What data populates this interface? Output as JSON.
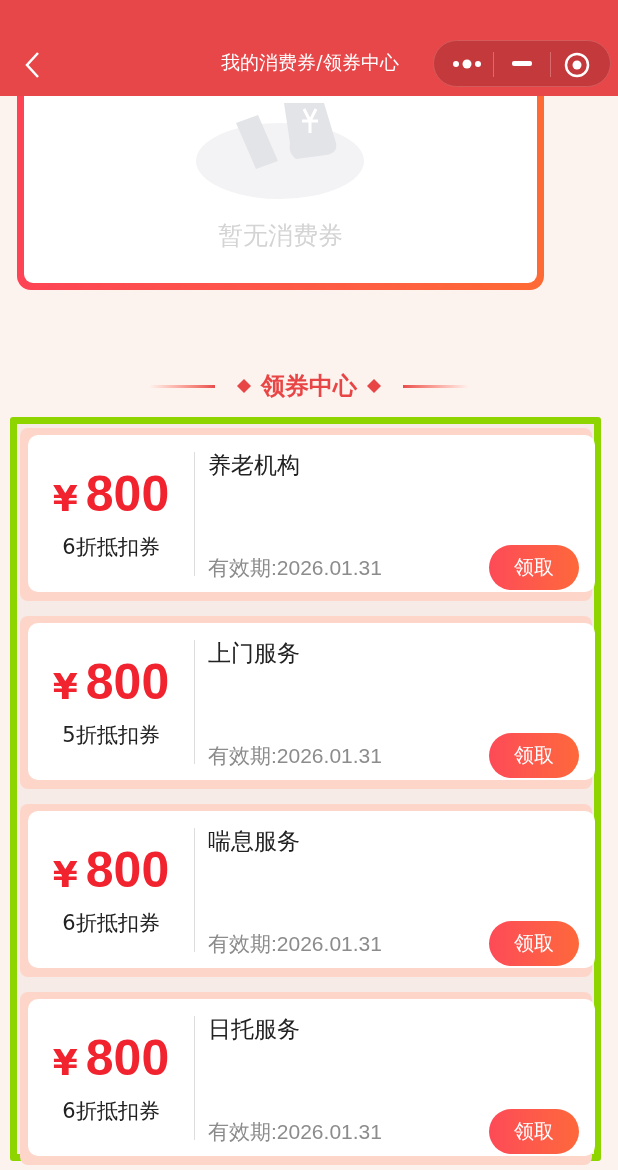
{
  "nav_bar": {
    "title": "我的消费券/领券中心"
  },
  "my_coupons": {
    "empty_text": "暂无消费券"
  },
  "section_title": "领券中心",
  "coupons": [
    {
      "currency": "¥",
      "amount": "800",
      "discount": "6折抵扣券",
      "name": "养老机构",
      "validity": "有效期:2026.01.31",
      "button": "领取"
    },
    {
      "currency": "¥",
      "amount": "800",
      "discount": "5折抵扣券",
      "name": "上门服务",
      "validity": "有效期:2026.01.31",
      "button": "领取"
    },
    {
      "currency": "¥",
      "amount": "800",
      "discount": "6折抵扣券",
      "name": "喘息服务",
      "validity": "有效期:2026.01.31",
      "button": "领取"
    },
    {
      "currency": "¥",
      "amount": "800",
      "discount": "6折抵扣券",
      "name": "日托服务",
      "validity": "有效期:2026.01.31",
      "button": "领取"
    }
  ]
}
